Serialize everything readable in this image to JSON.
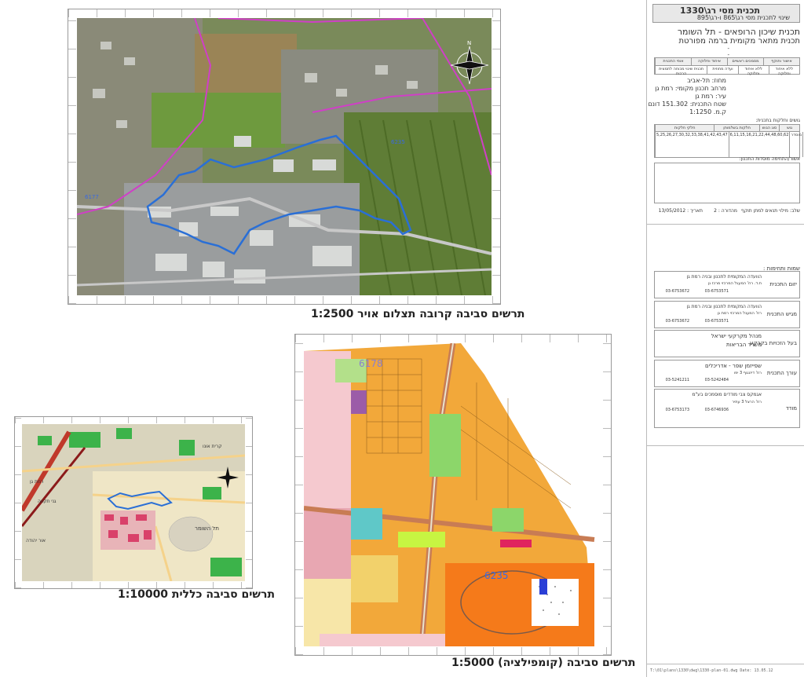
{
  "title_block": {
    "plan_title": "תכנית מסי רג\\1330",
    "plan_subtitle": "שינוי לתכנית מסי רג\\865 ו-רג\\895",
    "plan_name": "תכנית שיכון הרופאים - תל השומר",
    "plan_type": "תכנית מתאר מקומית ברמה מפורטת",
    "dash1": "-",
    "dash2": "-",
    "approval_headers": [
      "אישור ותוקף",
      "מסמכים ראשיים",
      "איחוד וחלוקה",
      "אופי התכנית"
    ],
    "approval_values": [
      "ללא איחוד וחלוקה",
      "תכנית שינוי מכוחה לתמצית הרכות",
      "ועדה מחוזית",
      "ללא איחוד וחלוקה"
    ],
    "district": "מחוז: תל-אביב",
    "planning_area": "מרחב תכנון מקומי: רמת גן",
    "city": "עיר: רמת גן",
    "area": "שטח התכנית: 151.302 דונם",
    "scale": "ק.מ. 1:1250",
    "parcels_title": "גושים וחלקות בתכנית:",
    "parcels_headers": [
      "גוש",
      "סוג הגוש",
      "חלקות בשלמותן",
      "חלקי חלקות"
    ],
    "parcels_row": [
      "6235",
      "מוסדר",
      "6,11,15,16,21,22,44,48,60,62",
      "5,25,26,27,30,32,33,38,41,42,43,47"
    ],
    "approval_box_title": "אשור/התחימה מוסדות התכנון:",
    "stage": "שלב: מילוי תנאים למתן תוקף",
    "edition": "מהדורה : 2",
    "date": "תאריך : 13/05/2012",
    "parties_title": "שמות ותחימות :",
    "parties": [
      {
        "role": "יזום התכנית",
        "name": "הוועדה המקומית לתכנון ובניה רמת גן",
        "addr": "ת.ד. רח' המעגל המרכזי מרכז גן",
        "tel": "03-6753571",
        "fax": "03-6753672"
      },
      {
        "role": "מגיש התכנית",
        "name": "הוועדה המקומית לתכנון ובניה רמת גן",
        "addr": "רח' המעגל המרכזי רמת גן",
        "tel": "03-6753571",
        "fax": "03-6753672"
      },
      {
        "role": "בעל הזכויות בקרקע",
        "name": "מנהל מקרקעי ישראל",
        "addr": "משרד הבריאות",
        "tel": "",
        "fax": ""
      },
      {
        "role": "עורך התכנית",
        "name": "שפייזמן שפר - אדריכלים",
        "addr": "רח' דיזנגוף 3 יפו",
        "tel": "03-5242484",
        "fax": "03-5241211"
      },
      {
        "role": "מודד",
        "name": "אגמקס צבי מודדים מוסמכים בע\"מ",
        "addr": "רח' הרצל 3 עתיר",
        "tel": "03-6746936",
        "fax": "03-6753173"
      }
    ]
  },
  "captions": {
    "aerial": "תרשים סביבה קרובה תצלום אויר 1:2500",
    "general": "תרשים סביבה כללית 1:10000",
    "compilation": "תרשים סביבה (קומפילציה) 1:5000"
  },
  "map_labels": {
    "aerial_block_a": "6235",
    "aerial_block_b": "6177",
    "comp_block_a": "6178",
    "comp_block_b": "6235",
    "north": "N",
    "general_tel_hashomer": "תל השומר",
    "general_ramat_gan": "רמת גן",
    "general_savyon": "גני תקווה",
    "general_kiryat_ono": "קרית אונו",
    "general_or_yehuda": "אור יהודה"
  },
  "footer": "T:\\01\\plans\\1330\\dwg\\1330-plan-01.dwg   Date: 13.05.12",
  "colors": {
    "plan_boundary": "#2a6fd6",
    "block_line": "#d03fc7",
    "residential": "#f0a030",
    "public": "#f57a1a",
    "green": "#8cd66a",
    "road": "#c87c54",
    "pink": "#f2b7c0"
  }
}
